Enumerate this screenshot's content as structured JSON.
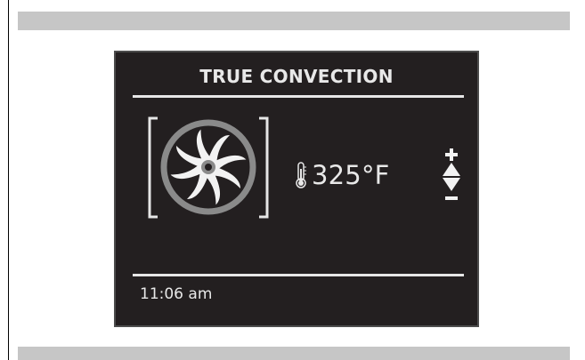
{
  "title": "TRUE CONVECTION",
  "temperature": "325°F",
  "time": "11:06 am",
  "icons": {
    "mode": "fan-icon",
    "temperature": "thermometer-icon",
    "increase": "plus-icon",
    "up": "arrow-up-icon",
    "down": "arrow-down-icon",
    "decrease": "minus-icon"
  },
  "colors": {
    "panel_bg": "#231f20",
    "text": "#e8e8e8",
    "fan_ring": "#8a8a8a",
    "bars": "#c6c6c6"
  }
}
